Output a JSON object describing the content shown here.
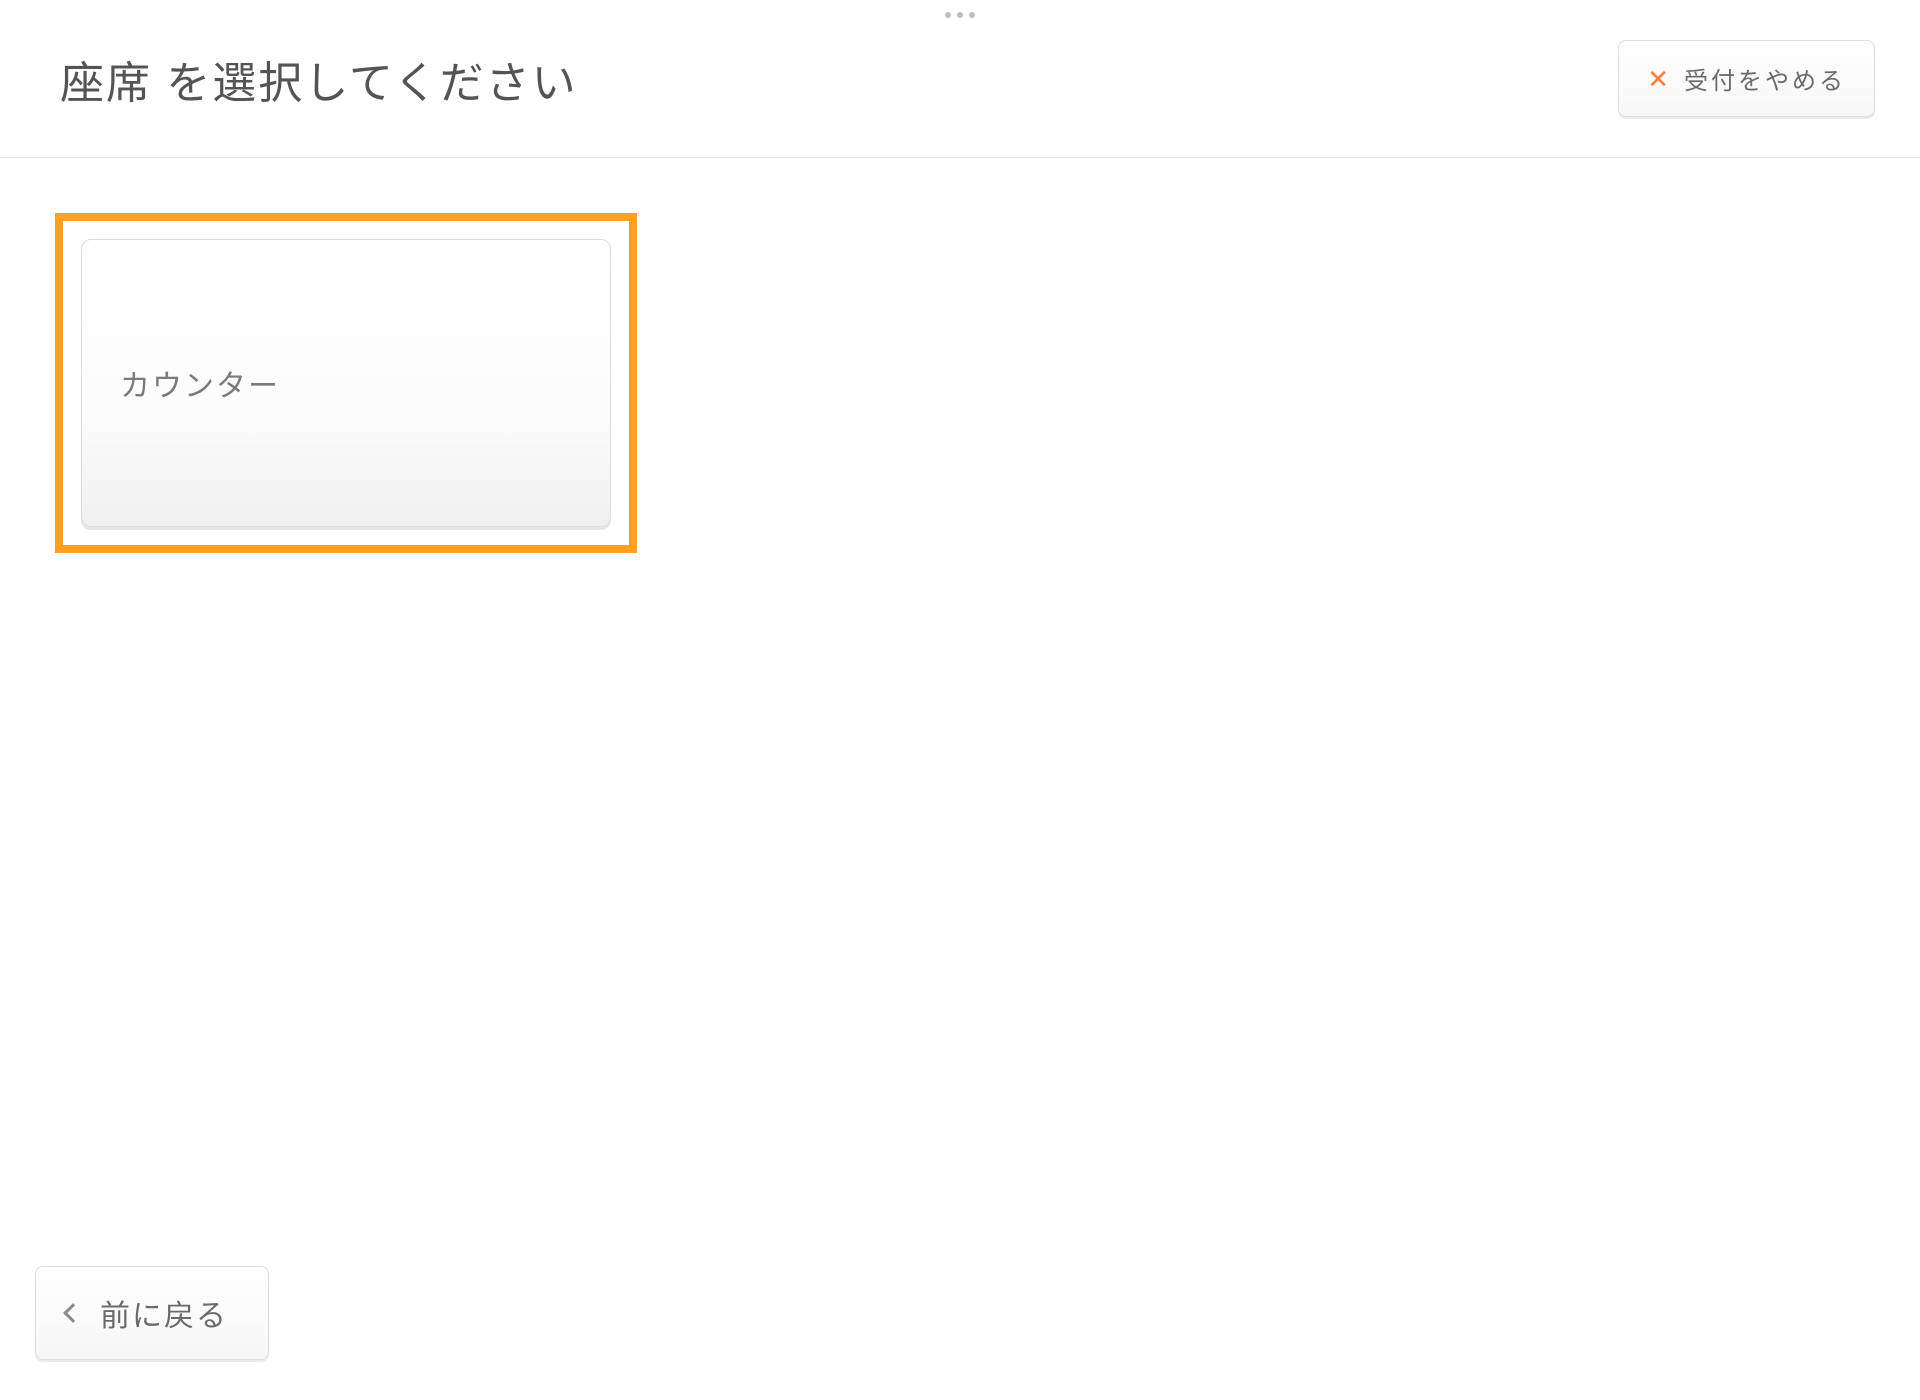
{
  "header": {
    "title": "座席 を選択してください",
    "cancel_label": "受付をやめる"
  },
  "seats": [
    {
      "label": "カウンター",
      "selected": true
    }
  ],
  "footer": {
    "back_label": "前に戻る"
  }
}
